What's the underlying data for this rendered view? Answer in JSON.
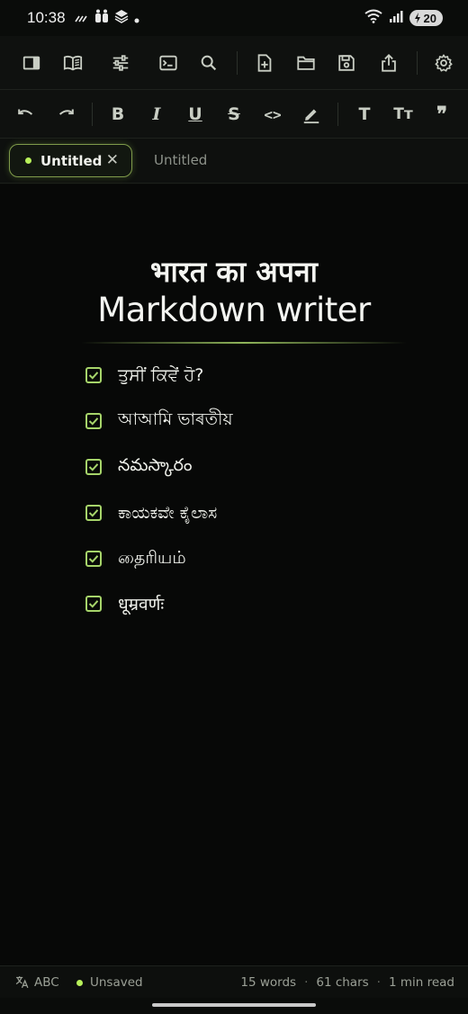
{
  "status_bar": {
    "time": "10:38",
    "battery": "20"
  },
  "toolbar_top": {
    "icons": [
      "sidebar-icon",
      "book-icon",
      "sliders-icon",
      "terminal-icon",
      "search-icon",
      "new-file-icon",
      "folder-icon",
      "save-icon",
      "share-icon",
      "gear-icon"
    ]
  },
  "toolbar_format": {
    "bold": "B",
    "italic": "I",
    "underline": "U",
    "strike": "S",
    "code": "<>",
    "heading": "T",
    "text_size": "Tт",
    "quote": "❞"
  },
  "tabs": [
    {
      "label": "Untitled",
      "active": true,
      "close": "✕"
    },
    {
      "label": "Untitled",
      "active": false
    }
  ],
  "document": {
    "title_line1": "भारत का अपना",
    "title_line2": "Markdown writer",
    "tasks": [
      {
        "text": "ਤੁਸੀਂ ਕਿਵੇਂ ਹੋ?",
        "checked": true
      },
      {
        "text": "আআমি ভাৰতীয়",
        "checked": true
      },
      {
        "text": "నమస్కారం",
        "checked": true
      },
      {
        "text": "ಕಾಯಕವೇ ಕೈಲಾಸ",
        "checked": true
      },
      {
        "text": "தைரியம்",
        "checked": true
      },
      {
        "text": "धूम्रवर्णः",
        "checked": true
      }
    ]
  },
  "footer": {
    "language": "ABC",
    "save_status": "Unsaved",
    "words": "15 words",
    "chars": "61 chars",
    "read_time": "1 min read",
    "separator": "·"
  },
  "colors": {
    "accent": "#b8f05a",
    "background": "#070807",
    "toolbar": "#0f110f"
  }
}
